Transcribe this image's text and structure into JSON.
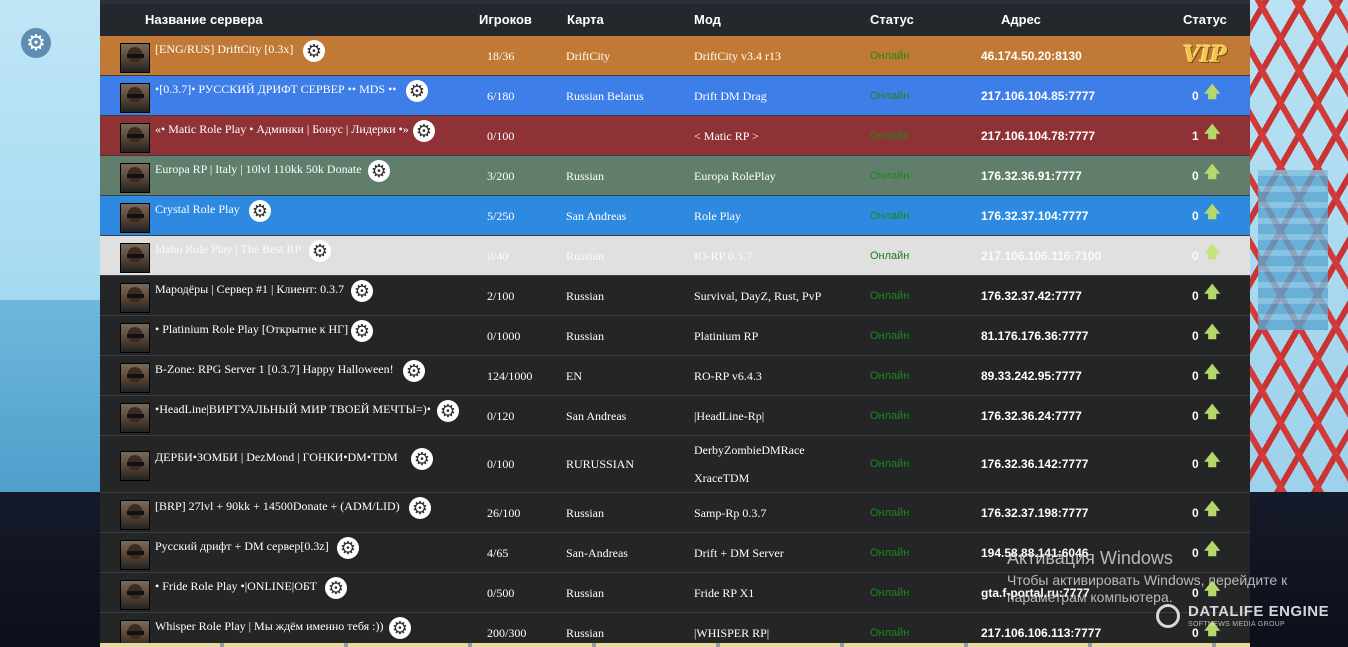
{
  "header": {
    "name": "Название сервера",
    "players": "Игроков",
    "map": "Карта",
    "mode": "Мод",
    "status": "Статус",
    "address": "Адрес",
    "rating": "Статус"
  },
  "servers": [
    {
      "name": "[ENG/RUS] DriftCity [0.3x]",
      "players": "18/36",
      "map": "DriftCity",
      "mode": "DriftCity v3.4 r13",
      "status": "Онлайн",
      "address": "46.174.50.20:8130",
      "votes": "",
      "vip": "VIP",
      "color": "#c07a35"
    },
    {
      "name": "•[0.3.7]• РУССКИЙ ДРИФТ СЕРВЕР •• MDS ••",
      "players": "6/180",
      "map": "Russian Belarus",
      "mode": "Drift DM Drag",
      "status": "Онлайн",
      "address": "217.106.104.85:7777",
      "votes": "0",
      "color": "#3e7ee8"
    },
    {
      "name": "«• Matic Role Play • Админки | Бонус | Лидерки •»",
      "players": "0/100",
      "map": "",
      "mode": "< Matic RP >",
      "status": "Онлайн",
      "address": "217.106.104.78:7777",
      "votes": "1",
      "color": "#8f3236"
    },
    {
      "name": "Europa RP | Italy | 10lvl 110kk 50k Donate",
      "players": "3/200",
      "map": "Russian",
      "mode": "Europa RolePlay",
      "status": "Онлайн",
      "address": "176.32.36.91:7777",
      "votes": "0",
      "color": "#607e6b"
    },
    {
      "name": "Crystal Role Play",
      "players": "5/250",
      "map": "San Andreas",
      "mode": "Role Play",
      "status": "Онлайн",
      "address": "176.32.37.104:7777",
      "votes": "0",
      "color": "#2d8ae0"
    },
    {
      "name": "Idaho Role Play | The Best RP",
      "players": "0/40",
      "map": "Russian",
      "mode": "IO-RP 0.3.7",
      "status": "Онлайн",
      "address": "217.106.106.116:7100",
      "votes": "0",
      "color": "#e0e0e0"
    },
    {
      "name": "Мародёры | Сервер #1 | Клиент: 0.3.7",
      "players": "2/100",
      "map": "Russian",
      "mode": "Survival, DayZ, Rust, PvP",
      "status": "Онлайн",
      "address": "176.32.37.42:7777",
      "votes": "0",
      "color": "#242527"
    },
    {
      "name": "• Platinium Role Play [Открытие к НГ] •",
      "players": "0/1000",
      "map": "Russian",
      "mode": "Platinium RP",
      "status": "Онлайн",
      "address": "81.176.176.36:7777",
      "votes": "0",
      "color": "#242527"
    },
    {
      "name": "B-Zone: RPG Server 1 [0.3.7] Happy Halloween!",
      "players": "124/1000",
      "map": "EN",
      "mode": "RO-RP v6.4.3",
      "status": "Онлайн",
      "address": "89.33.242.95:7777",
      "votes": "0",
      "color": "#242527"
    },
    {
      "name": "•HeadLine|ВИРТУАЛЬНЫЙ МИР ТВОЕЙ МЕЧТЫ=)•",
      "players": "0/120",
      "map": "San Andreas",
      "mode": "|HeadLine-Rp|",
      "status": "Онлайн",
      "address": "176.32.36.24:7777",
      "votes": "0",
      "color": "#242527"
    },
    {
      "name": "ДЕРБИ•ЗОМБИ | DezMond | ГОНКИ•DM•TDM",
      "players": "0/100",
      "map": "RURUSSIAN",
      "mode": "DerbyZombieDMRace",
      "mode2": "XraceTDM",
      "status": "Онлайн",
      "address": "176.32.36.142:7777",
      "votes": "0",
      "color": "#242527"
    },
    {
      "name": "[BRP] 27lvl + 90kk + 14500Donate + (ADM/LID)",
      "players": "26/100",
      "map": "Russian",
      "mode": "Samp-Rp 0.3.7",
      "status": "Онлайн",
      "address": "176.32.37.198:7777",
      "votes": "0",
      "color": "#242527"
    },
    {
      "name": "Русский дрифт + DM сервер[0.3z]",
      "players": "4/65",
      "map": "San-Andreas",
      "mode": "Drift + DM Server",
      "status": "Онлайн",
      "address": "194.58.88.141:6046",
      "votes": "0",
      "color": "#242527"
    },
    {
      "name": "• Fride Role Play •|ONLINE|ОБТ",
      "players": "0/500",
      "map": "Russian",
      "mode": "Fride RP X1",
      "status": "Онлайн",
      "address": "gta.f-portal.ru:7777",
      "votes": "0",
      "color": "#242527"
    },
    {
      "name": "Whisper Role Play | Мы ждём именно тебя :))",
      "players": "200/300",
      "map": "Russian",
      "mode": "|WHISPER RP|",
      "status": "Онлайн",
      "address": "217.106.106.113:7777",
      "votes": "0",
      "color": "#242527"
    }
  ],
  "watermark": {
    "title": "Активация Windows",
    "line1": "Чтобы активировать Windows, перейдите к",
    "line2": "параметрам компьютера."
  },
  "dle": {
    "name": "DATALIFE ENGINE",
    "sub": "SOFTNEWS MEDIA GROUP"
  },
  "icons": {
    "settings": "gear-icon",
    "vote": "arrow-up-icon"
  }
}
